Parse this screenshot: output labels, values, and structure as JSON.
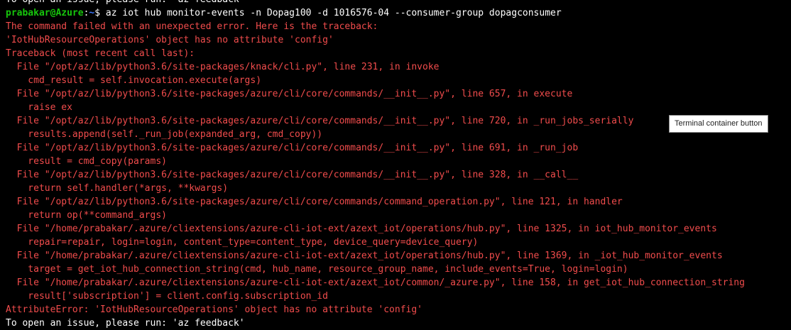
{
  "colors": {
    "background": "#000000",
    "text": "#ffffff",
    "error": "#f14c4c",
    "prompt_user": "#16c60c",
    "prompt_path": "#3b78ff"
  },
  "prompt": {
    "user_host": "prabakar@Azure",
    "separator": ":",
    "path": "~",
    "symbol": "$ ",
    "command": "az iot hub monitor-events -n Dopag100 -d 1016576-04 --consumer-group dopagconsumer"
  },
  "output": {
    "top_partial": "To open an issue, please run: 'az feedback'",
    "lines": [
      "The command failed with an unexpected error. Here is the traceback:",
      "'IotHubResourceOperations' object has no attribute 'config'",
      "Traceback (most recent call last):",
      "  File \"/opt/az/lib/python3.6/site-packages/knack/cli.py\", line 231, in invoke",
      "    cmd_result = self.invocation.execute(args)",
      "  File \"/opt/az/lib/python3.6/site-packages/azure/cli/core/commands/__init__.py\", line 657, in execute",
      "    raise ex",
      "  File \"/opt/az/lib/python3.6/site-packages/azure/cli/core/commands/__init__.py\", line 720, in _run_jobs_serially",
      "    results.append(self._run_job(expanded_arg, cmd_copy))",
      "  File \"/opt/az/lib/python3.6/site-packages/azure/cli/core/commands/__init__.py\", line 691, in _run_job",
      "    result = cmd_copy(params)",
      "  File \"/opt/az/lib/python3.6/site-packages/azure/cli/core/commands/__init__.py\", line 328, in __call__",
      "    return self.handler(*args, **kwargs)",
      "  File \"/opt/az/lib/python3.6/site-packages/azure/cli/core/commands/command_operation.py\", line 121, in handler",
      "    return op(**command_args)",
      "  File \"/home/prabakar/.azure/cliextensions/azure-cli-iot-ext/azext_iot/operations/hub.py\", line 1325, in iot_hub_monitor_events",
      "    repair=repair, login=login, content_type=content_type, device_query=device_query)",
      "  File \"/home/prabakar/.azure/cliextensions/azure-cli-iot-ext/azext_iot/operations/hub.py\", line 1369, in _iot_hub_monitor_events",
      "    target = get_iot_hub_connection_string(cmd, hub_name, resource_group_name, include_events=True, login=login)",
      "  File \"/home/prabakar/.azure/cliextensions/azure-cli-iot-ext/azext_iot/common/_azure.py\", line 158, in get_iot_hub_connection_string",
      "    result['subscription'] = client.config.subscription_id"
    ],
    "error_summary": "AttributeError: 'IotHubResourceOperations' object has no attribute 'config'",
    "bottom_partial": "To open an issue, please run: 'az feedback'"
  },
  "tooltip": {
    "text": "Terminal container button"
  }
}
